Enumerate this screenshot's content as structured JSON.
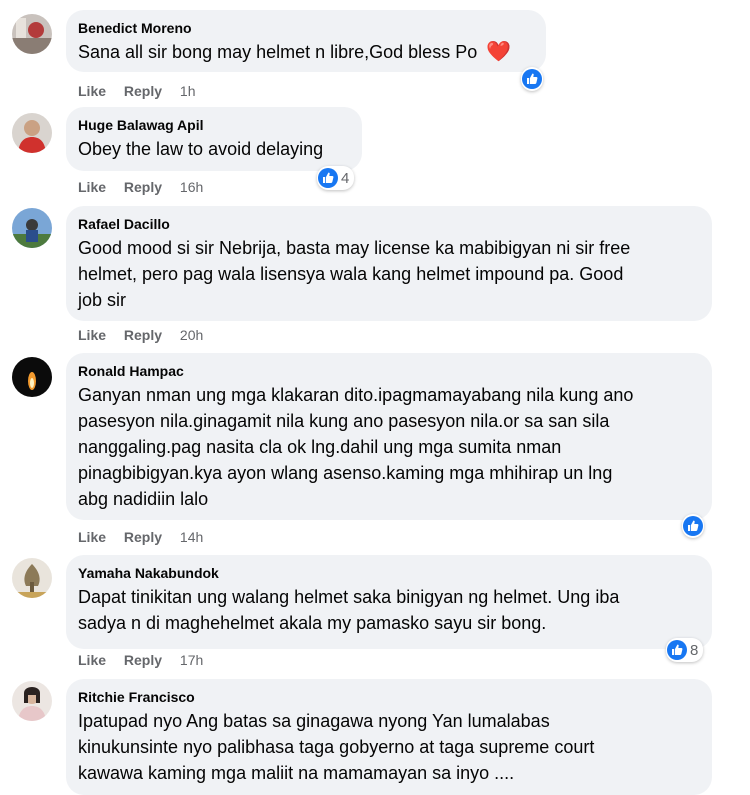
{
  "labels": {
    "like": "Like",
    "reply": "Reply"
  },
  "comments": [
    {
      "name": "Benedict Moreno",
      "text": "Sana all sir bong may helmet n libre,God bless Po",
      "emoji": "❤️",
      "time": "1h",
      "reaction": {
        "icon": "like-icon",
        "count": ""
      }
    },
    {
      "name": "Huge Balawag Apil",
      "text": "Obey the law to avoid delaying",
      "time": "16h",
      "reaction": {
        "icon": "like-icon",
        "count": "4"
      }
    },
    {
      "name": "Rafael Dacillo",
      "text": "Good mood si sir Nebrija, basta may license ka mabibigyan ni sir free\nhelmet, pero pag wala lisensya wala kang helmet impound pa. Good\njob sir",
      "time": "20h",
      "reaction": null
    },
    {
      "name": "Ronald Hampac",
      "text": "Ganyan nman ung mga klakaran dito.ipagmamayabang nila kung ano\npasesyon nila.ginagamit nila kung ano pasesyon nila.or sa san sila\nnanggaling.pag nasita cla ok lng.dahil ung mga sumita nman\npinagbibigyan.kya ayon wlang asenso.kaming mga mhihirap un lng\nabg nadidiin lalo",
      "time": "14h",
      "reaction": {
        "icon": "like-icon",
        "count": ""
      }
    },
    {
      "name": "Yamaha Nakabundok",
      "text": "Dapat tinikitan ung walang helmet saka binigyan ng helmet. Ung iba\nsadya n di maghehelmet akala my pamasko sayu sir bong.",
      "time": "17h",
      "reaction": {
        "icon": "like-icon",
        "count": "8"
      }
    },
    {
      "name": "Ritchie Francisco",
      "text": "Ipatupad nyo Ang batas sa ginagawa nyong Yan lumalabas\nkinukunsinte nyo palibhasa taga gobyerno at taga supreme court\nkawawa kaming mga maliit na mamamayan sa inyo ....",
      "time": "",
      "reaction": null
    }
  ],
  "colors": {
    "bubble": "#f0f2f5",
    "meta_text": "#65676b",
    "like_blue": "#1877f2",
    "heart_red": "#e41e3f"
  }
}
